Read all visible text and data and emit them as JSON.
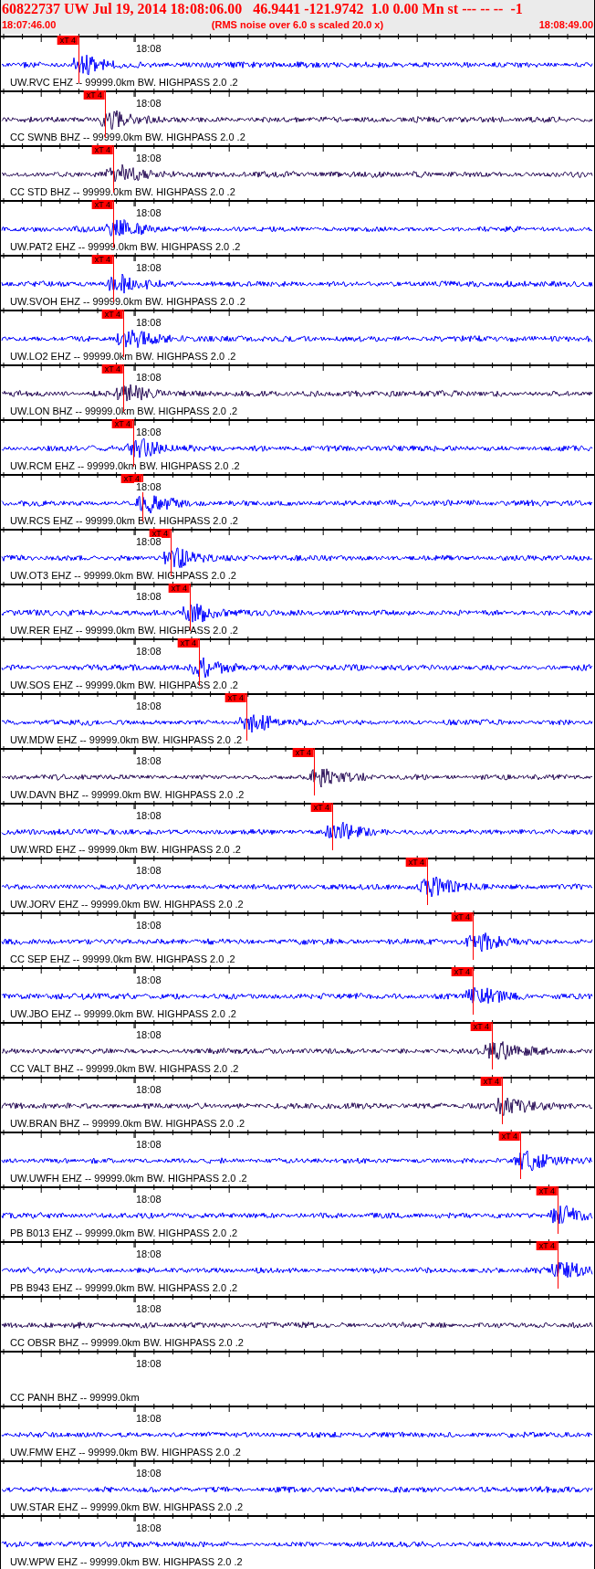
{
  "header": {
    "title": "60822737 UW Jul 19, 2014 18:08:06.00   46.9441 -121.9742  1.0 0.00 Mn st --- -- --  -1",
    "start_time": "18:07:46.00",
    "note": "(RMS noise over 6.0 s scaled 20.0 x)",
    "end_time": "18:08:49.00"
  },
  "traces": [
    {
      "label": "UW.RVC EHZ -- 99999.0km BW. HIGHPASS 2.0 .2",
      "time_mark": "18:08",
      "color": "#0000ff",
      "pick": "xT 4"
    },
    {
      "label": "CC SWNB BHZ -- 99999.0km BW. HIGHPASS 2.0 .2",
      "time_mark": "18:08",
      "color": "#2a0f58",
      "pick": "xT 4"
    },
    {
      "label": "CC STD BHZ -- 99999.0km BW. HIGHPASS 2.0 .2",
      "time_mark": "18:08",
      "color": "#2a0f58",
      "pick": "xT 4"
    },
    {
      "label": "UW.PAT2 EHZ -- 99999.0km BW. HIGHPASS 2.0 .2",
      "time_mark": "18:08",
      "color": "#0000ff",
      "pick": "xT 4"
    },
    {
      "label": "UW.SVOH EHZ -- 99999.0km BW. HIGHPASS 2.0 .2",
      "time_mark": "18:08",
      "color": "#0000ff",
      "pick": "xT 4"
    },
    {
      "label": "UW.LO2 EHZ -- 99999.0km BW. HIGHPASS 2.0 .2",
      "time_mark": "18:08",
      "color": "#0000ff",
      "pick": "xT 4"
    },
    {
      "label": "UW.LON BHZ -- 99999.0km BW. HIGHPASS 2.0 .2",
      "time_mark": "18:08",
      "color": "#2a0f58",
      "pick": "xT 4"
    },
    {
      "label": "UW.RCM EHZ -- 99999.0km BW. HIGHPASS 2.0 .2",
      "time_mark": "18:08",
      "color": "#0000ff",
      "pick": "xT 4"
    },
    {
      "label": "UW.RCS EHZ -- 99999.0km BW. HIGHPASS 2.0 .2",
      "time_mark": "18:08",
      "color": "#0000ff",
      "pick": "xT 4"
    },
    {
      "label": "UW.OT3 EHZ -- 99999.0km BW. HIGHPASS 2.0 .2",
      "time_mark": "18:08",
      "color": "#0000ff",
      "pick": "xT 4"
    },
    {
      "label": "UW.RER EHZ -- 99999.0km BW. HIGHPASS 2.0 .2",
      "time_mark": "18:08",
      "color": "#0000ff",
      "pick": "xT 4"
    },
    {
      "label": "UW.SOS EHZ -- 99999.0km BW. HIGHPASS 2.0 .2",
      "time_mark": "18:08",
      "color": "#0000ff",
      "pick": "xT 4"
    },
    {
      "label": "UW.MDW EHZ -- 99999.0km BW. HIGHPASS 2.0 .2",
      "time_mark": "18:08",
      "color": "#0000ff",
      "pick": "xT 4"
    },
    {
      "label": "UW.DAVN BHZ -- 99999.0km BW. HIGHPASS 2.0 .2",
      "time_mark": "18:08",
      "color": "#2a0f58",
      "pick": "xT 4"
    },
    {
      "label": "UW.WRD EHZ -- 99999.0km BW. HIGHPASS 2.0 .2",
      "time_mark": "18:08",
      "color": "#0000ff",
      "pick": "xT 4"
    },
    {
      "label": "UW.JORV EHZ -- 99999.0km BW. HIGHPASS 2.0 .2",
      "time_mark": "18:08",
      "color": "#0000ff",
      "pick": "xT 4"
    },
    {
      "label": "CC SEP EHZ -- 99999.0km BW. HIGHPASS 2.0 .2",
      "time_mark": "18:08",
      "color": "#0000ff",
      "pick": "xT 4"
    },
    {
      "label": "UW.JBO EHZ -- 99999.0km BW. HIGHPASS 2.0 .2",
      "time_mark": "18:08",
      "color": "#0000ff",
      "pick": "xT 4"
    },
    {
      "label": "CC VALT BHZ -- 99999.0km BW. HIGHPASS 2.0 .2",
      "time_mark": "18:08",
      "color": "#2a0f58",
      "pick": "xT 4"
    },
    {
      "label": "UW.BRAN BHZ -- 99999.0km BW. HIGHPASS 2.0 .2",
      "time_mark": "18:08",
      "color": "#2a0f58",
      "pick": "xT 4"
    },
    {
      "label": "UW.UWFH EHZ -- 99999.0km BW. HIGHPASS 2.0 .2",
      "time_mark": "18:08",
      "color": "#0000ff",
      "pick": "xT 4"
    },
    {
      "label": "PB B013 EHZ -- 99999.0km BW. HIGHPASS 2.0 .2",
      "time_mark": "18:08",
      "color": "#0000ff",
      "pick": "xT 4"
    },
    {
      "label": "PB B943 EHZ -- 99999.0km BW. HIGHPASS 2.0 .2",
      "time_mark": "18:08",
      "color": "#0000ff",
      "pick": "xT 4"
    },
    {
      "label": "CC OBSR BHZ -- 99999.0km BW. HIGHPASS 2.0 .2",
      "time_mark": "18:08",
      "color": "#2a0f58"
    },
    {
      "label": "CC PANH BHZ -- 99999.0km",
      "time_mark": "18:08"
    },
    {
      "label": "UW.FMW EHZ -- 99999.0km BW. HIGHPASS 2.0 .2",
      "time_mark": "18:08",
      "color": "#0000ff"
    },
    {
      "label": "UW.STAR EHZ -- 99999.0km BW. HIGHPASS 2.0 .2",
      "time_mark": "18:08",
      "color": "#0000ff"
    },
    {
      "label": "UW.WPW EHZ -- 99999.0km BW. HIGHPASS 2.0 .2",
      "time_mark": "18:08",
      "color": "#0000ff"
    }
  ]
}
